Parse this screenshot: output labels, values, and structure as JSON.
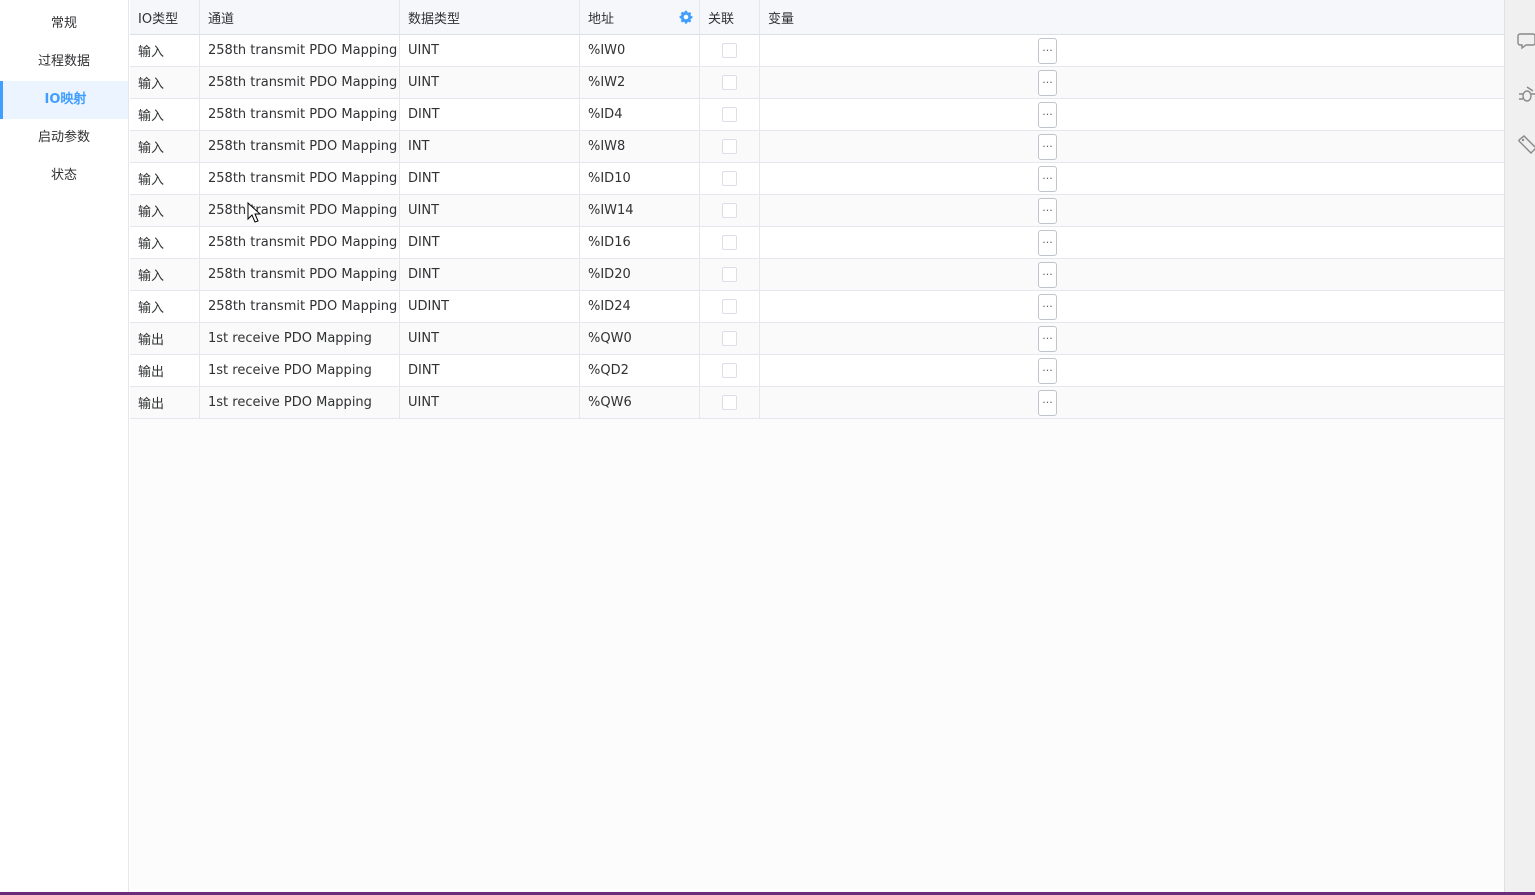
{
  "sidebar": {
    "items": [
      {
        "label": "常规",
        "active": false
      },
      {
        "label": "过程数据",
        "active": false
      },
      {
        "label": "IO映射",
        "active": true
      },
      {
        "label": "启动参数",
        "active": false
      },
      {
        "label": "状态",
        "active": false
      }
    ]
  },
  "table": {
    "headers": {
      "io_type": "IO类型",
      "channel": "通道",
      "data_type": "数据类型",
      "address": "地址",
      "link": "关联",
      "variable": "变量"
    },
    "ellipsis_label": "...",
    "rows": [
      {
        "io_type": "输入",
        "channel": "258th transmit PDO Mapping",
        "data_type": "UINT",
        "address": "%IW0",
        "linked": false,
        "variable": ""
      },
      {
        "io_type": "输入",
        "channel": "258th transmit PDO Mapping",
        "data_type": "UINT",
        "address": "%IW2",
        "linked": false,
        "variable": ""
      },
      {
        "io_type": "输入",
        "channel": "258th transmit PDO Mapping",
        "data_type": "DINT",
        "address": "%ID4",
        "linked": false,
        "variable": ""
      },
      {
        "io_type": "输入",
        "channel": "258th transmit PDO Mapping",
        "data_type": "INT",
        "address": "%IW8",
        "linked": false,
        "variable": ""
      },
      {
        "io_type": "输入",
        "channel": "258th transmit PDO Mapping",
        "data_type": "DINT",
        "address": "%ID10",
        "linked": false,
        "variable": ""
      },
      {
        "io_type": "输入",
        "channel": "258th transmit PDO Mapping",
        "data_type": "UINT",
        "address": "%IW14",
        "linked": false,
        "variable": ""
      },
      {
        "io_type": "输入",
        "channel": "258th transmit PDO Mapping",
        "data_type": "DINT",
        "address": "%ID16",
        "linked": false,
        "variable": ""
      },
      {
        "io_type": "输入",
        "channel": "258th transmit PDO Mapping",
        "data_type": "DINT",
        "address": "%ID20",
        "linked": false,
        "variable": ""
      },
      {
        "io_type": "输入",
        "channel": "258th transmit PDO Mapping",
        "data_type": "UDINT",
        "address": "%ID24",
        "linked": false,
        "variable": ""
      },
      {
        "io_type": "输出",
        "channel": "1st receive PDO Mapping",
        "data_type": "UINT",
        "address": "%QW0",
        "linked": false,
        "variable": ""
      },
      {
        "io_type": "输出",
        "channel": "1st receive PDO Mapping",
        "data_type": "DINT",
        "address": "%QD2",
        "linked": false,
        "variable": ""
      },
      {
        "io_type": "输出",
        "channel": "1st receive PDO Mapping",
        "data_type": "UINT",
        "address": "%QW6",
        "linked": false,
        "variable": ""
      }
    ]
  },
  "colors": {
    "accent": "#409eff",
    "bottom_bar": "#6b2d7a"
  },
  "icons": {
    "address_settings": "gear-icon",
    "right_toolbar": [
      "chat-icon",
      "bug-icon",
      "tag-icon"
    ]
  }
}
